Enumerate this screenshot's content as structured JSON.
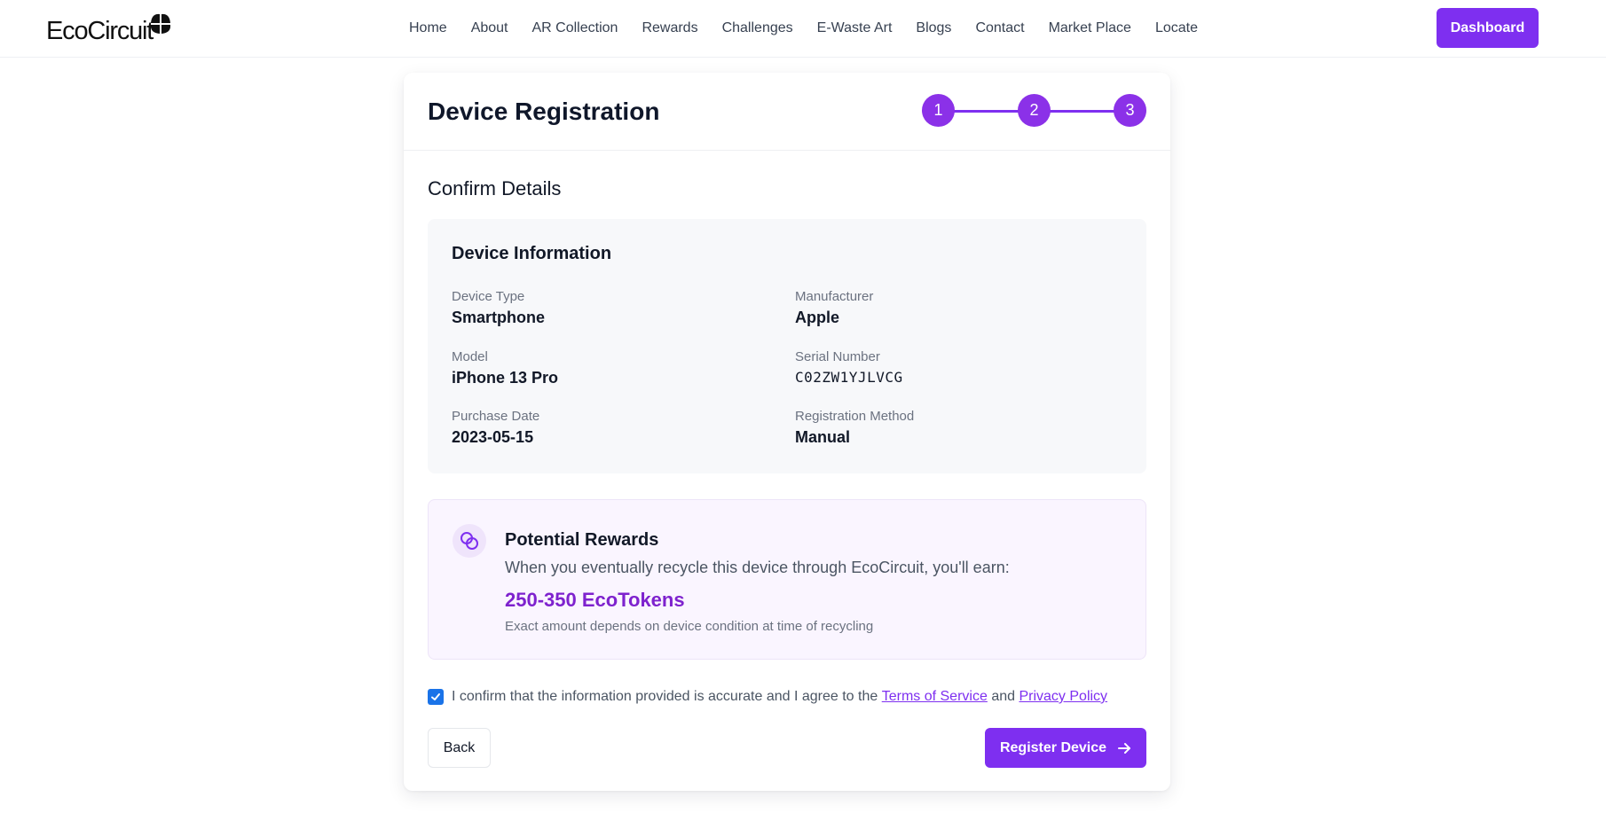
{
  "brand": {
    "name": "EcoCircuit",
    "logo_icon": "four-leaf-icon"
  },
  "nav": {
    "items": [
      "Home",
      "About",
      "AR Collection",
      "Rewards",
      "Challenges",
      "E-Waste Art",
      "Blogs",
      "Contact",
      "Market Place",
      "Locate"
    ],
    "dashboard_label": "Dashboard"
  },
  "colors": {
    "accent": "#7e2ff0",
    "reward_text": "#7e22ce",
    "panel_bg": "#f7f8fa",
    "reward_bg": "#faf5ff"
  },
  "registration": {
    "title": "Device Registration",
    "steps": [
      "1",
      "2",
      "3"
    ],
    "current_step": 3,
    "section_title": "Confirm Details",
    "device_info": {
      "title": "Device Information",
      "fields": [
        {
          "label": "Device Type",
          "value": "Smartphone"
        },
        {
          "label": "Manufacturer",
          "value": "Apple"
        },
        {
          "label": "Model",
          "value": "iPhone 13 Pro"
        },
        {
          "label": "Serial Number",
          "value": "C02ZW1YJLVCG"
        },
        {
          "label": "Purchase Date",
          "value": "2023-05-15"
        },
        {
          "label": "Registration Method",
          "value": "Manual"
        }
      ]
    },
    "rewards": {
      "icon": "coins-icon",
      "title": "Potential Rewards",
      "description": "When you eventually recycle this device through EcoCircuit, you'll earn:",
      "amount": "250-350 EcoTokens",
      "note": "Exact amount depends on device condition at time of recycling"
    },
    "confirm": {
      "checked": true,
      "text_before": "I confirm that the information provided is accurate and I agree to the",
      "terms_label": "Terms of Service",
      "and_text": "and",
      "privacy_label": "Privacy Policy"
    },
    "back_label": "Back",
    "register_label": "Register Device"
  }
}
